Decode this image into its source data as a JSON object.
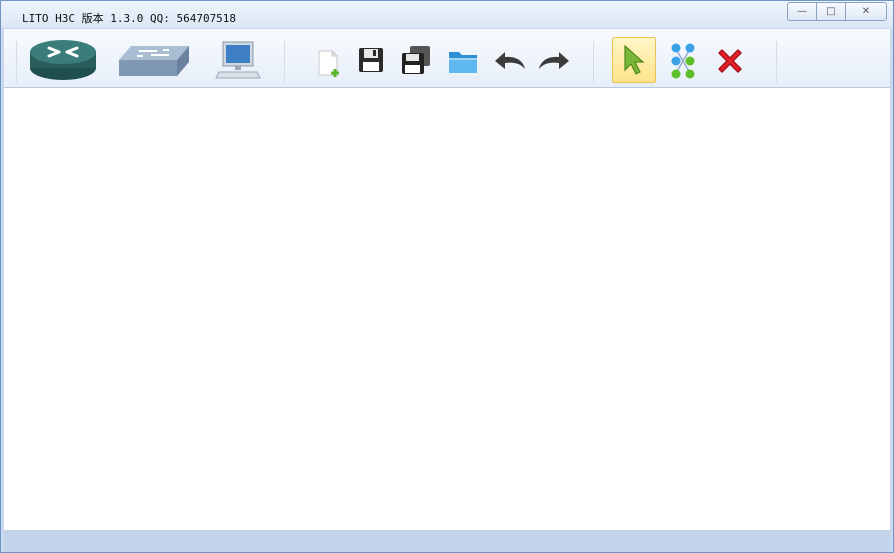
{
  "window": {
    "title": "LITO H3C 版本 1.3.0 QQ: 564707518",
    "controls": {
      "minimize": "—",
      "restore": "□",
      "close": "✕"
    }
  },
  "toolbar": {
    "device_tools": [
      {
        "name": "router",
        "icon": "router-icon"
      },
      {
        "name": "switch",
        "icon": "switch-icon"
      },
      {
        "name": "pc",
        "icon": "pc-icon"
      }
    ],
    "file_tools": [
      {
        "name": "new",
        "icon": "new-file-icon"
      },
      {
        "name": "save",
        "icon": "save-icon"
      },
      {
        "name": "save-as",
        "icon": "save-as-icon"
      },
      {
        "name": "open",
        "icon": "open-folder-icon"
      },
      {
        "name": "undo",
        "icon": "undo-icon"
      },
      {
        "name": "redo",
        "icon": "redo-icon"
      }
    ],
    "edit_tools": [
      {
        "name": "select",
        "icon": "select-arrow-icon",
        "active": true
      },
      {
        "name": "connect",
        "icon": "connect-icon"
      },
      {
        "name": "delete",
        "icon": "delete-icon"
      }
    ]
  },
  "colors": {
    "router": "#2f6b6a",
    "switch": "#8aa2bd",
    "select_arrow": "#7ab83a",
    "delete": "#e8202a",
    "connect_blue": "#3aa0e8",
    "connect_green": "#5fbf2a"
  }
}
